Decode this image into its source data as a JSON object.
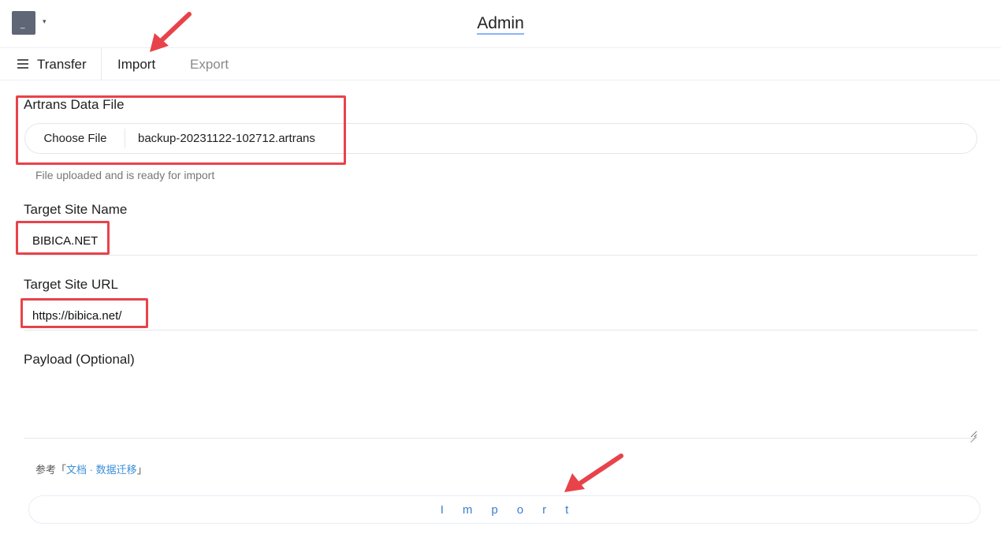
{
  "header": {
    "title": "Admin",
    "avatar_glyph": "_",
    "caret": "▾"
  },
  "tabs": [
    {
      "label": "Transfer"
    },
    {
      "label": "Import"
    },
    {
      "label": "Export"
    }
  ],
  "form": {
    "file_label": "Artrans Data File",
    "choose_button": "Choose File",
    "file_name": "backup-20231122-102712.artrans",
    "file_hint": "File uploaded and is ready for import",
    "site_name_label": "Target Site Name",
    "site_name_value": "BIBICA.NET",
    "site_url_label": "Target Site URL",
    "site_url_value": "https://bibica.net/",
    "payload_label": "Payload (Optional)",
    "payload_value": ""
  },
  "reference": {
    "prefix": "参考「",
    "link": "文档 · 数据迁移",
    "suffix": "」"
  },
  "import_button": "Import",
  "colors": {
    "annotation": "#e8434a",
    "link": "#3b8fd6",
    "import_text": "#3b7fd0"
  }
}
